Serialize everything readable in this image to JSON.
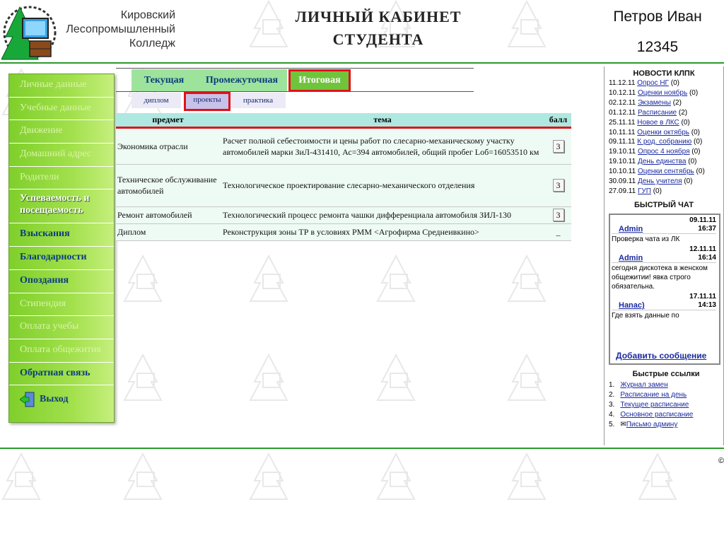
{
  "header": {
    "college_name": [
      "Кировский",
      "Лесопромышленный",
      "Колледж"
    ],
    "page_title": [
      "ЛИЧНЫЙ КАБИНЕТ",
      "СТУДЕНТА"
    ],
    "user_name": "Петров Иван",
    "user_id": "12345"
  },
  "sidebar": {
    "items": [
      {
        "label": "Личные данные",
        "state": "disabled"
      },
      {
        "label": "Учебные данные",
        "state": "disabled"
      },
      {
        "label": "Движение",
        "state": "disabled"
      },
      {
        "label": "Домашний адрес",
        "state": "disabled"
      },
      {
        "label": "Родители",
        "state": "disabled"
      },
      {
        "label": "Успеваемость и посещаемость",
        "state": "current"
      },
      {
        "label": "Взыскания",
        "state": "active"
      },
      {
        "label": "Благодарности",
        "state": "active"
      },
      {
        "label": "Опоздания",
        "state": "active"
      },
      {
        "label": "Стипендия",
        "state": "disabled"
      },
      {
        "label": "Оплата учебы",
        "state": "disabled"
      },
      {
        "label": "Оплата общежития",
        "state": "disabled"
      },
      {
        "label": "Обратная связь",
        "state": "active"
      }
    ],
    "exit_label": "Выход"
  },
  "tabs": [
    "Текущая",
    "Промежуточная",
    "Итоговая"
  ],
  "subtabs": [
    "диплом",
    "проекты",
    "практика"
  ],
  "table": {
    "headers": [
      "предмет",
      "тема",
      "балл"
    ],
    "rows": [
      {
        "subject": "Экономика отрасли",
        "topic": "Расчет полной себестоимости и цены работ по слесарно-механическому участку автомобилей марки ЗиЛ-431410, Ас=394 автомобилей, общий пробег Lоб=16053510 км",
        "score": "3"
      },
      {
        "subject": "Техническое обслуживание автомобилей",
        "topic": "Технологическое проектирование слесарно-механического отделения",
        "score": "3"
      },
      {
        "subject": "Ремонт автомобилей",
        "topic": "Технологический процесс ремонта чашки дифференциала автомобиля ЗИЛ-130",
        "score": "3"
      },
      {
        "subject": "Диплом",
        "topic": "Реконструкция зоны ТР в условиях РММ <Агрофирма Среднеивкино>",
        "score": "_"
      }
    ]
  },
  "news": {
    "title": "НОВОСТИ КЛПК",
    "items": [
      {
        "date": "11.12.11",
        "title": "Опрос НГ",
        "count": "(0)"
      },
      {
        "date": "10.12.11",
        "title": "Оценки ноябрь",
        "count": "(0)"
      },
      {
        "date": "02.12.11",
        "title": "Экзамены",
        "count": "(2)"
      },
      {
        "date": "01.12.11",
        "title": "Расписание",
        "count": "(2)"
      },
      {
        "date": "25.11.11",
        "title": "Новое в ЛКС",
        "count": "(0)"
      },
      {
        "date": "10.11.11",
        "title": "Оценки октябрь",
        "count": "(0)"
      },
      {
        "date": "09.11.11",
        "title": "К род. собранию",
        "count": "(0)"
      },
      {
        "date": "19.10.11",
        "title": "Опрос 4 ноября",
        "count": "(0)"
      },
      {
        "date": "19.10.11",
        "title": "День единства",
        "count": "(0)"
      },
      {
        "date": "10.10.11",
        "title": "Оценки сентябрь",
        "count": "(0)"
      },
      {
        "date": "30.09.11",
        "title": "День учителя",
        "count": "(0)"
      },
      {
        "date": "27.09.11",
        "title": "ГУП",
        "count": "(0)"
      }
    ]
  },
  "chat": {
    "title": "БЫСТРЫЙ ЧАТ",
    "messages": [
      {
        "user": "Admin",
        "date": "09.11.11",
        "time": "16:37",
        "text": "Проверка чата из ЛК"
      },
      {
        "user": "Admin",
        "date": "12.11.11",
        "time": "16:14",
        "text": "сегодня дискотека в женском общежитии! явка строго обязательна."
      },
      {
        "user": "Нanac)",
        "date": "17.11.11",
        "time": "14:13",
        "text": "Где взять данные по"
      }
    ],
    "add_label": "Добавить сообщение"
  },
  "quick_links": {
    "title": "Быстрые ссылки",
    "items": [
      {
        "num": "1.",
        "label": "Журнал замен"
      },
      {
        "num": "2.",
        "label": "Расписание на день"
      },
      {
        "num": "3.",
        "label": "Текущее расписание"
      },
      {
        "num": "4.",
        "label": "Основное расписание"
      },
      {
        "num": "5.",
        "label": "Письмо админу"
      }
    ]
  },
  "copyright": "©",
  "colors": {
    "accent_green": "#2c9a2c",
    "highlight_red": "#e0121a",
    "link_blue": "#1a2aa0"
  }
}
